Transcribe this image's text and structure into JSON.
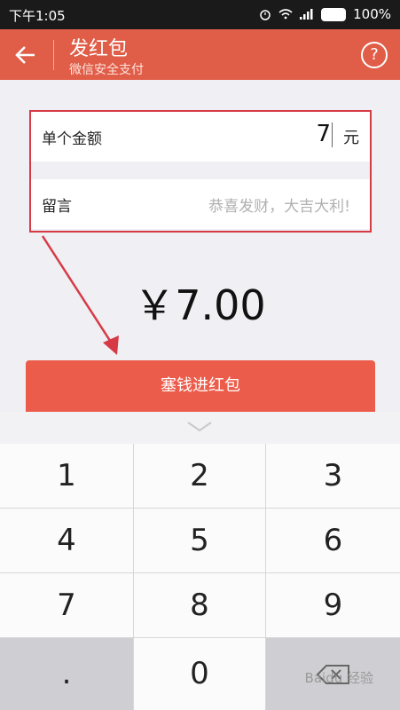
{
  "status": {
    "time": "下午1:05",
    "battery": "100%"
  },
  "header": {
    "title": "发红包",
    "subtitle": "微信安全支付",
    "help": "?"
  },
  "form": {
    "amount_label": "单个金额",
    "amount_value": "7",
    "unit": "元",
    "note_label": "留言",
    "note_placeholder": "恭喜发财，大吉大利!"
  },
  "total": "￥7.00",
  "submit_label": "塞钱进红包",
  "keypad": {
    "k1": "1",
    "k2": "2",
    "k3": "3",
    "k4": "4",
    "k5": "5",
    "k6": "6",
    "k7": "7",
    "k8": "8",
    "k9": "9",
    "dot": ".",
    "k0": "0"
  },
  "watermark": "Baidu 经验",
  "colors": {
    "header": "#e05d48",
    "button": "#ec5c4b",
    "highlight_border": "#d63a45"
  }
}
